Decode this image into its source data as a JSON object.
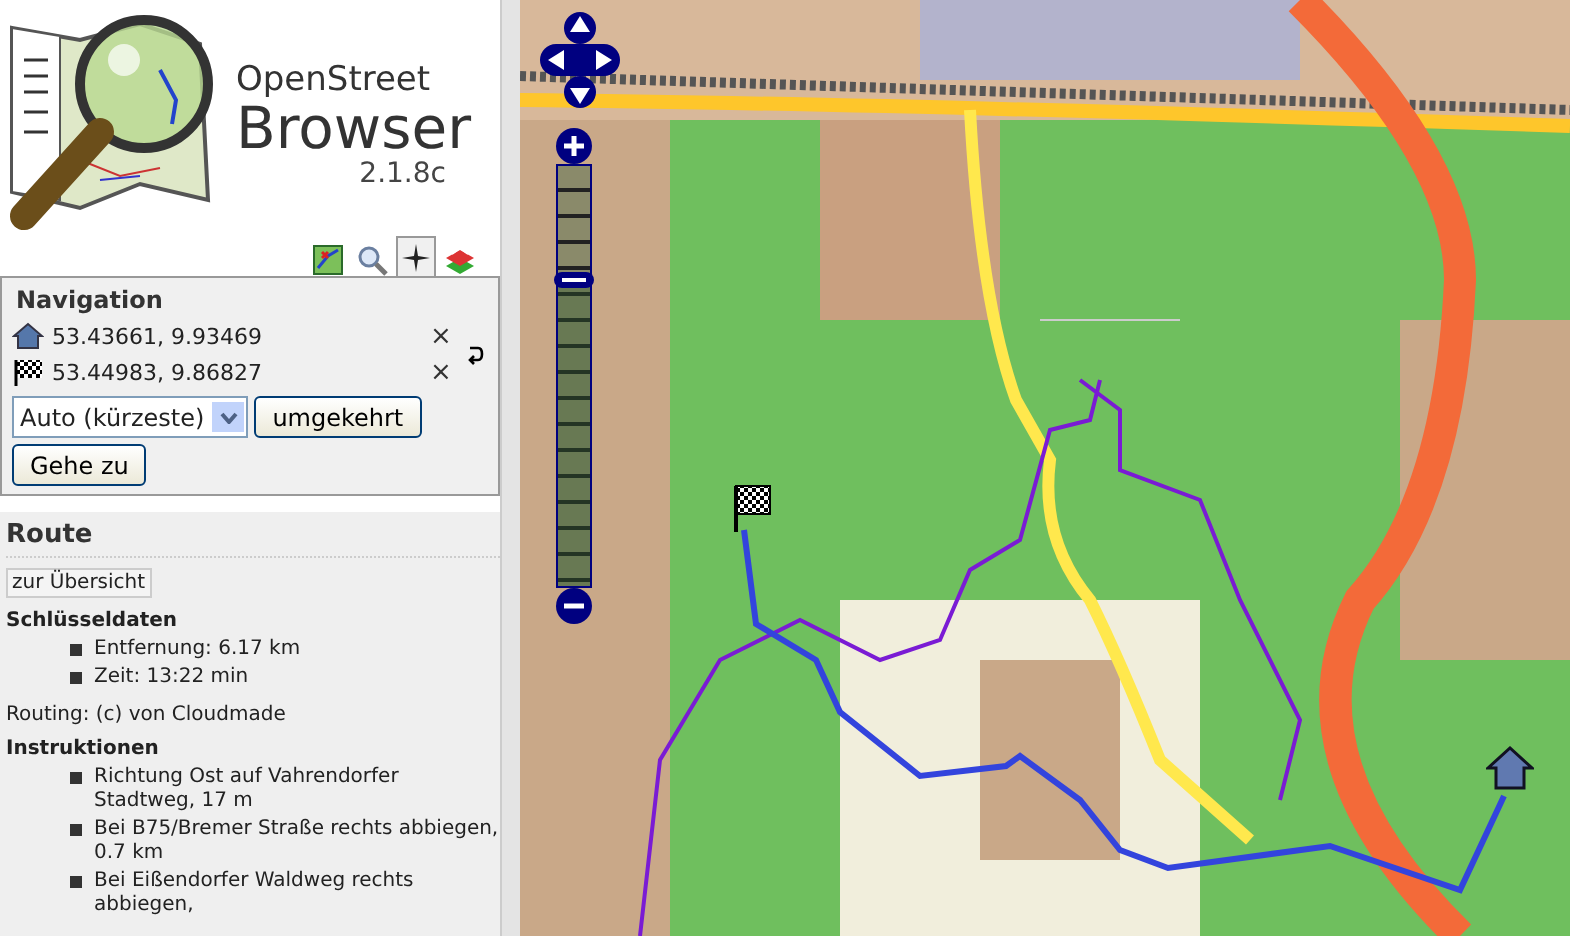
{
  "logo": {
    "line_1": "OpenStreet",
    "line_2": "Browser",
    "version": "2.1.8c"
  },
  "tabs": [
    {
      "selected": false
    },
    {
      "selected": false
    },
    {
      "selected": true
    },
    {
      "selected": false
    }
  ],
  "navigation": {
    "title": "Navigation",
    "points": [
      {
        "kind": "start",
        "coords": "53.43661, 9.93469",
        "remove": "×"
      },
      {
        "kind": "end",
        "coords": "53.44983, 9.86827",
        "remove": "×"
      }
    ],
    "mode": {
      "value": "Auto (kürzeste)"
    },
    "reverse_button": "umgekehrt",
    "go_button": "Gehe zu"
  },
  "route": {
    "title": "Route",
    "overview_button": "zur Übersicht",
    "key_data_title": "Schlüsseldaten",
    "key_data": [
      "Entfernung: 6.17 km",
      "Zeit: 13:22 min"
    ],
    "credit": "Routing: (c) von Cloudmade",
    "instructions_title": "Instruktionen",
    "instructions": [
      "Richtung Ost auf Vahrendorfer Stadtweg, 17 m",
      "Bei B75/Bremer Straße rechts abbiegen, 0.7 km",
      "Bei Eißendorfer Waldweg rechts abbiegen,"
    ]
  },
  "map": {
    "zoom": {
      "level": 0.74
    }
  }
}
